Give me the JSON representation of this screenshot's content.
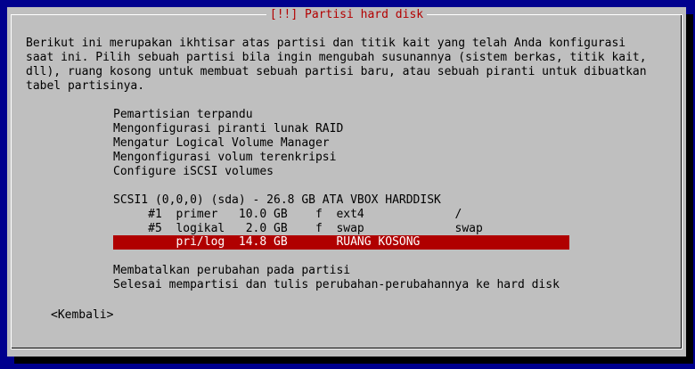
{
  "dialog": {
    "title": "[!!] Partisi hard disk",
    "description": [
      "Berikut ini merupakan ikhtisar atas partisi dan titik kait yang telah Anda konfigurasi",
      "saat ini. Pilih sebuah partisi bila ingin mengubah susunannya (sistem berkas, titik kait,",
      "dll), ruang kosong untuk membuat sebuah partisi baru, atau sebuah piranti untuk dibuatkan",
      "tabel partisinya."
    ],
    "tools": [
      "Pemartisian terpandu",
      "Mengonfigurasi piranti lunak RAID",
      "Mengatur Logical Volume Manager",
      "Mengonfigurasi volum terenkripsi",
      "Configure iSCSI volumes"
    ],
    "disk": "SCSI1 (0,0,0) (sda) - 26.8 GB ATA VBOX HARDDISK",
    "partitions": [
      "     #1  primer   10.0 GB    f  ext4             /",
      "     #5  logikal   2.0 GB    f  swap             swap",
      "         pri/log  14.8 GB       RUANG KOSONG"
    ],
    "actions": [
      "Membatalkan perubahan pada partisi",
      "Selesai mempartisi dan tulis perubahan-perubahannya ke hard disk"
    ],
    "back_button": "<Kembali>"
  },
  "colors": {
    "background": "#00008e",
    "dialog": "#bfbfbf",
    "title": "#b30000",
    "selection": "#b00000"
  }
}
